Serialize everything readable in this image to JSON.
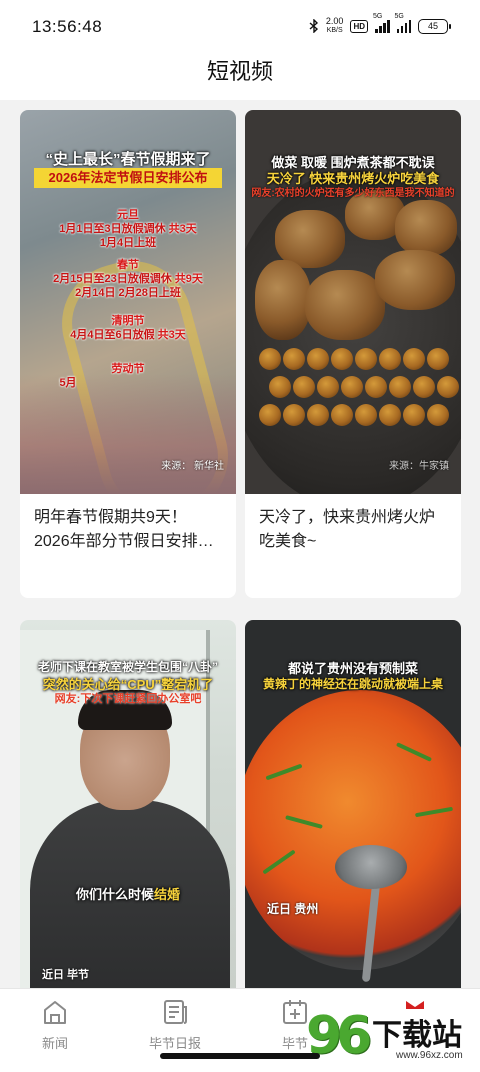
{
  "status_bar": {
    "time": "13:56:48",
    "net_speed_value": "2.00",
    "net_speed_unit": "KB/S",
    "hd_label": "HD",
    "signal1_label": "5G",
    "signal2_label": "5G",
    "battery": "45"
  },
  "header": {
    "title": "短视频"
  },
  "cards": [
    {
      "caption": "明年春节假期共9天！2026年部分节假日安排…",
      "overlay": {
        "headline": "“史上最长”春节假期来了",
        "banner": "2026年法定节假日安排公布",
        "h1_name": "元旦",
        "h1_line1": "1月1日至3日放假调休",
        "h1_days": "共3天",
        "h1_line2": "1月4日上班",
        "h2_name": "春节",
        "h2_line1": "2月15日至23日放假调休",
        "h2_days": "共9天",
        "h2_line2": "2月14日  2月28日上班",
        "h3_name": "清明节",
        "h3_line1": "4月4日至6日放假",
        "h3_days": "共3天",
        "h4_name": "劳动节",
        "h4_line1": "5月",
        "source": "来源：  新华社"
      }
    },
    {
      "caption": "天冷了，快来贵州烤火炉吃美食~",
      "overlay": {
        "line1": "做菜 取暖 围炉煮茶都不耽误",
        "line2": "天冷了 快来贵州烤火炉吃美食",
        "line3": "网友:农村的火炉还有多少好东西是我不知道的",
        "source": "来源：牛家镇",
        "potatoes_count": 6,
        "chestnuts_count": 24
      }
    },
    {
      "caption": "",
      "overlay": {
        "line1": "老师下课在教室被学生包围“八卦”",
        "line2": "突然的关心给“CPU”整宕机了",
        "line3": "网友:下次下课赶紧回办公室吧",
        "subtitle_prefix": "你们什么时候",
        "subtitle_hl": "结婚",
        "tag": "近日  毕节"
      }
    },
    {
      "caption": "",
      "overlay": {
        "line1": "都说了贵州没有预制菜",
        "line2": "黄辣丁的神经还在跳动就被端上桌",
        "tag": "近日  贵州",
        "greens_count": 5
      }
    }
  ],
  "bottom_nav": [
    {
      "label": "新闻",
      "icon": "home-icon"
    },
    {
      "label": "毕节日报",
      "icon": "newspaper-icon"
    },
    {
      "label": "毕节",
      "icon": "calendar-plus-icon"
    },
    {
      "label": "",
      "icon": "gift-icon"
    }
  ],
  "watermark": {
    "number": "96",
    "text": "下载站",
    "url": "www.96xz.com"
  },
  "colors": {
    "accent_yellow": "#f4d534",
    "accent_red": "#d81818",
    "nav_gray": "#8a8a8a",
    "watermark_green": "#4aa830"
  }
}
